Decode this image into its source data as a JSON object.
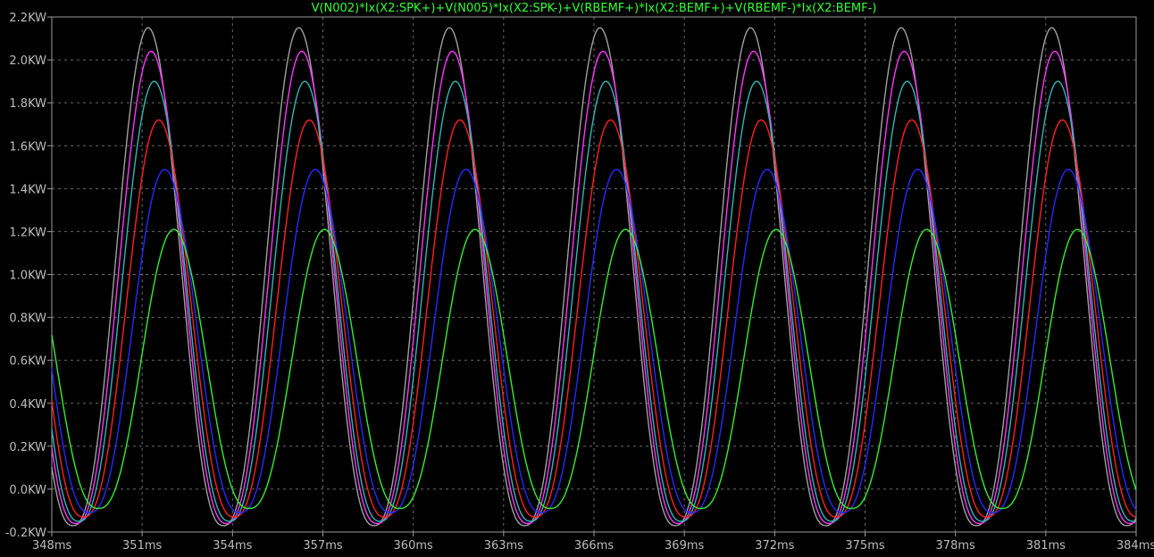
{
  "window": {
    "background": "#000000",
    "frame_color": "#9a9a9a",
    "grid_color": "#6a6a6a"
  },
  "chart_data": {
    "type": "line",
    "title": "V(N002)*Ix(X2:SPK+)+V(N005)*Ix(X2:SPK-)+V(RBEMF+)*Ix(X2:BEMF+)+V(RBEMF-)*Ix(X2:BEMF-)",
    "title_color": "#33ff33",
    "xlabel": "",
    "ylabel": "",
    "xlim": [
      348,
      384
    ],
    "ylim": [
      -0.2,
      2.2
    ],
    "x_unit": "ms",
    "y_unit": "KW",
    "grid": true,
    "grid_style": "dashed",
    "x_ticks": [
      "348ms",
      "351ms",
      "354ms",
      "357ms",
      "360ms",
      "363ms",
      "366ms",
      "369ms",
      "372ms",
      "375ms",
      "378ms",
      "381ms",
      "384ms"
    ],
    "y_ticks": [
      "2.2KW",
      "2.0KW",
      "1.8KW",
      "1.6KW",
      "1.4KW",
      "1.2KW",
      "1.0KW",
      "0.8KW",
      "0.6KW",
      "0.4KW",
      "0.2KW",
      "0.0KW",
      "-0.2KW"
    ],
    "period_ms": 5.0,
    "first_peak_ms": 351.2,
    "series": [
      {
        "color": "#a0a0a0",
        "peak": 2.15,
        "trough": -0.17,
        "phase_lag_ms": 0.0
      },
      {
        "color": "#ff33ff",
        "peak": 2.04,
        "trough": -0.16,
        "phase_lag_ms": 0.1
      },
      {
        "color": "#33b5b5",
        "peak": 1.9,
        "trough": -0.15,
        "phase_lag_ms": 0.2
      },
      {
        "color": "#ff2020",
        "peak": 1.72,
        "trough": -0.13,
        "phase_lag_ms": 0.35
      },
      {
        "color": "#2828ff",
        "peak": 1.49,
        "trough": -0.11,
        "phase_lag_ms": 0.55
      },
      {
        "color": "#33ee33",
        "peak": 1.21,
        "trough": -0.09,
        "phase_lag_ms": 0.85
      }
    ]
  }
}
